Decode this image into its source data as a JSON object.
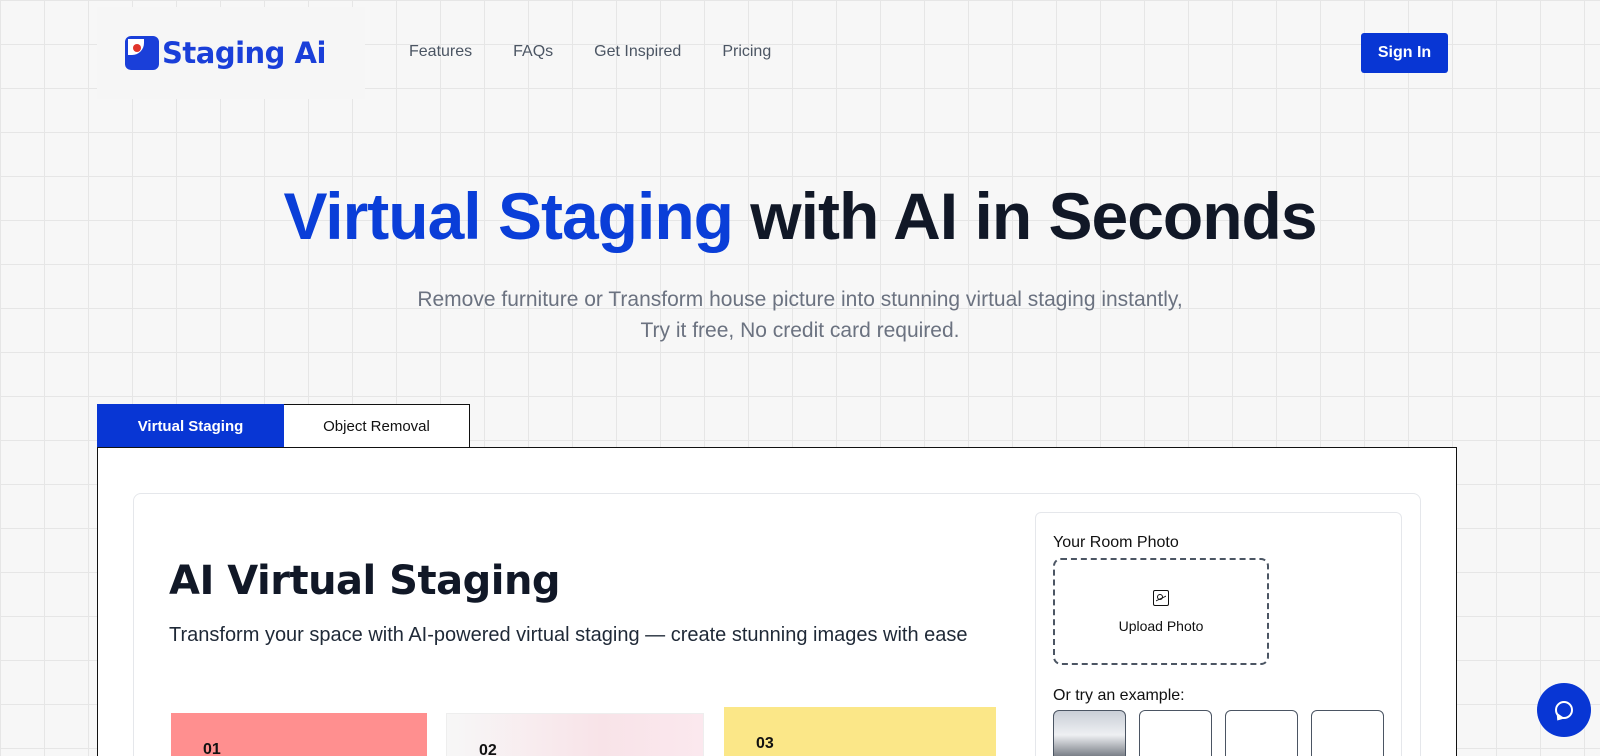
{
  "brand": {
    "logo_text": "Staging Ai",
    "accent_color": "#0836d4"
  },
  "nav": {
    "items": [
      "Features",
      "FAQs",
      "Get Inspired",
      "Pricing"
    ]
  },
  "header": {
    "signin_label": "Sign In"
  },
  "hero": {
    "title_accent": "Virtual Staging",
    "title_rest": " with AI in Seconds",
    "subtitle_line1": "Remove furniture or Transform house picture into stunning virtual staging instantly,",
    "subtitle_line2": "Try it free, No credit card required."
  },
  "tabs": [
    {
      "label": "Virtual Staging",
      "active": true
    },
    {
      "label": "Object Removal",
      "active": false
    }
  ],
  "card": {
    "title": "AI Virtual Staging",
    "description": "Transform your space with AI-powered virtual staging — create stunning images with ease",
    "steps": [
      "01",
      "02",
      "03"
    ]
  },
  "upload": {
    "label": "Your Room Photo",
    "button_label": "Upload Photo",
    "examples_label": "Or try an example:"
  },
  "icons": {
    "upload": "image-icon",
    "chat": "chat-bubble-icon"
  }
}
